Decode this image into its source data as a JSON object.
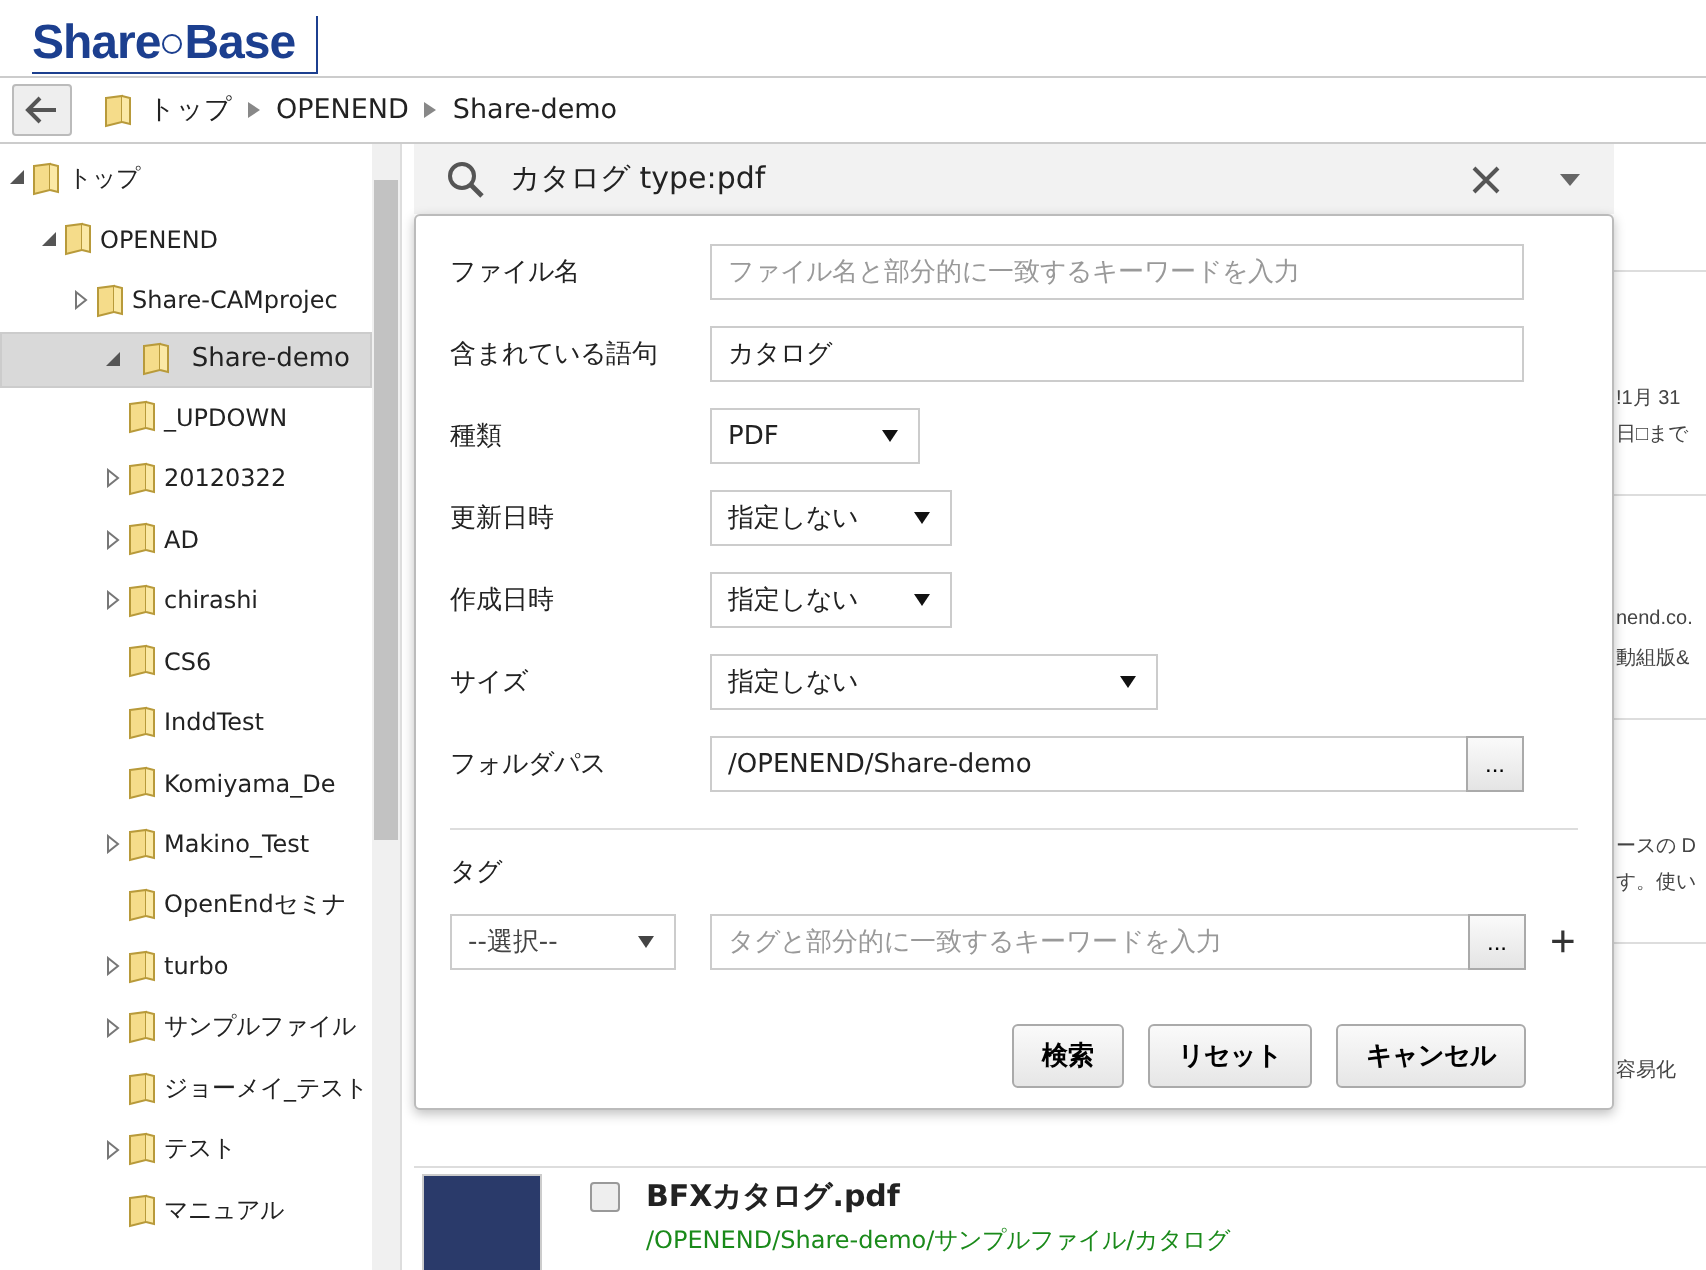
{
  "logo": {
    "text": "Share",
    "text2": "Base"
  },
  "breadcrumb": {
    "items": [
      "トップ",
      "OPENEND",
      "Share-demo"
    ]
  },
  "tree": [
    {
      "label": "トップ",
      "kind": "branch",
      "expanded": true,
      "selected": false,
      "children": [
        {
          "label": "OPENEND",
          "kind": "branch",
          "expanded": true,
          "selected": false,
          "children": [
            {
              "label": "Share-CAMprojec",
              "kind": "branch",
              "expanded": false,
              "selected": false
            },
            {
              "label": "Share-demo",
              "kind": "branch",
              "expanded": true,
              "selected": true,
              "children": [
                {
                  "label": "_UPDOWN",
                  "kind": "leaf",
                  "selected": false
                },
                {
                  "label": "20120322",
                  "kind": "branch",
                  "expanded": false,
                  "selected": false
                },
                {
                  "label": "AD",
                  "kind": "branch",
                  "expanded": false,
                  "selected": false
                },
                {
                  "label": "chirashi",
                  "kind": "branch",
                  "expanded": false,
                  "selected": false
                },
                {
                  "label": "CS6",
                  "kind": "leaf",
                  "selected": false
                },
                {
                  "label": "InddTest",
                  "kind": "leaf",
                  "selected": false
                },
                {
                  "label": "Komiyama_De",
                  "kind": "leaf",
                  "selected": false
                },
                {
                  "label": "Makino_Test",
                  "kind": "branch",
                  "expanded": false,
                  "selected": false
                },
                {
                  "label": "OpenEndセミナ",
                  "kind": "leaf",
                  "selected": false
                },
                {
                  "label": "turbo",
                  "kind": "branch",
                  "expanded": false,
                  "selected": false
                },
                {
                  "label": "サンプルファイル",
                  "kind": "branch",
                  "expanded": false,
                  "selected": false
                },
                {
                  "label": "ジョーメイ_テスト",
                  "kind": "leaf",
                  "selected": false
                },
                {
                  "label": "テスト",
                  "kind": "branch",
                  "expanded": false,
                  "selected": false
                },
                {
                  "label": "マニュアル",
                  "kind": "leaf",
                  "selected": false
                }
              ]
            }
          ]
        }
      ]
    }
  ],
  "search": {
    "query": "カタログ type:pdf"
  },
  "advanced": {
    "fields": [
      {
        "kind": "text",
        "label": "ファイル名",
        "placeholder": "ファイル名と部分的に一致するキーワードを入力"
      },
      {
        "kind": "text",
        "label": "含まれている語句",
        "value": "カタログ"
      },
      {
        "kind": "select",
        "label": "種類",
        "value": "PDF"
      },
      {
        "kind": "select",
        "label": "更新日時",
        "value": "指定しない"
      },
      {
        "kind": "select",
        "label": "作成日時",
        "value": "指定しない"
      },
      {
        "kind": "select",
        "label": "サイズ",
        "value": "指定しない"
      },
      {
        "kind": "browse",
        "label": "フォルダパス",
        "value": "/OPENEND/Share-demo",
        "button": "..."
      }
    ],
    "tag": {
      "label": "タグ",
      "select": "--選択--",
      "placeholder": "タグと部分的に一致するキーワードを入力",
      "button": "...",
      "add": "+"
    },
    "buttons": [
      "検索",
      "リセット",
      "キャンセル"
    ]
  },
  "results": [
    {
      "fragments": [
        "!1月 31",
        "日□まで"
      ]
    },
    {
      "fragments": [
        "nend.co.",
        "動組版&"
      ]
    },
    {
      "fragments": [
        "ースの D",
        "す。使い"
      ]
    },
    {
      "fragments": [
        "容易化"
      ]
    },
    {
      "title": "BFXカタログ.pdf",
      "path": "/OPENEND/Share-demo/サンプルファイル/カタログ",
      "checked": false
    }
  ]
}
